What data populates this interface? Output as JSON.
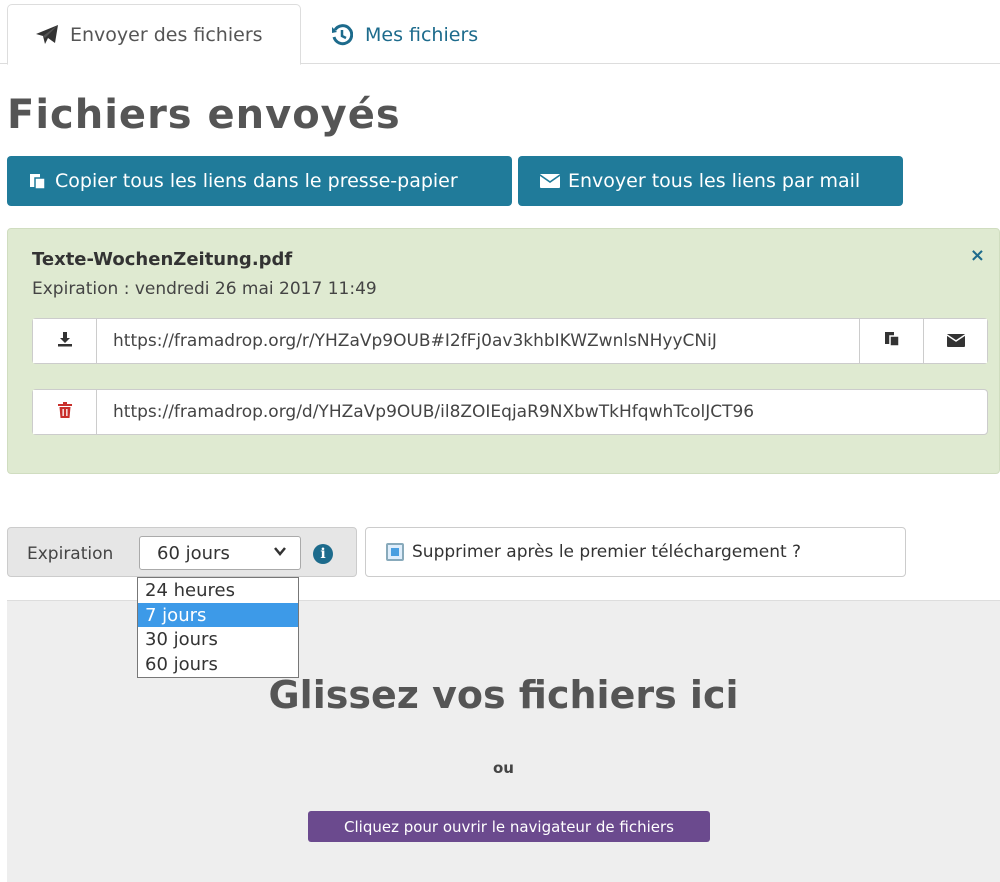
{
  "tabs": {
    "send": {
      "label": "Envoyer des fichiers",
      "icon": "paper-plane-icon"
    },
    "mine": {
      "label": "Mes fichiers",
      "icon": "history-icon"
    }
  },
  "page_title": "Fichiers envoyés",
  "actions": {
    "copy_all": {
      "label": "Copier tous les liens dans le presse-papier",
      "icon": "clipboard-icon"
    },
    "mail_all": {
      "label": "Envoyer tous les liens par mail",
      "icon": "envelope-icon"
    }
  },
  "upload": {
    "filename": "Texte-WochenZeitung.pdf",
    "expiration": "Expiration : vendredi 26 mai 2017 11:49",
    "close": "×",
    "download_url": "https://framadrop.org/r/YHZaVp9OUB#I2fFj0av3khbIKWZwnlsNHyyCNiJ",
    "delete_url": "https://framadrop.org/d/YHZaVp9OUB/il8ZOIEqjaR9NXbwTkHfqwhTcolJCT96"
  },
  "options": {
    "expiration_label": "Expiration",
    "expiration_selected": "60 jours",
    "expiration_options": [
      "24 heures",
      "7 jours",
      "30 jours",
      "60 jours"
    ],
    "highlighted_option": "7 jours",
    "delete_after_download_label": "Supprimer après le premier téléchargement ?",
    "delete_after_download_checked": true
  },
  "dropzone": {
    "title": "Glissez vos fichiers ici",
    "or": "ou",
    "browse_label": "Cliquez pour ouvrir le navigateur de fichiers"
  },
  "colors": {
    "primary": "#207b9a",
    "success_panel": "#dfead1",
    "browse_button": "#6b4a8e",
    "danger_icon": "#c9302c"
  }
}
